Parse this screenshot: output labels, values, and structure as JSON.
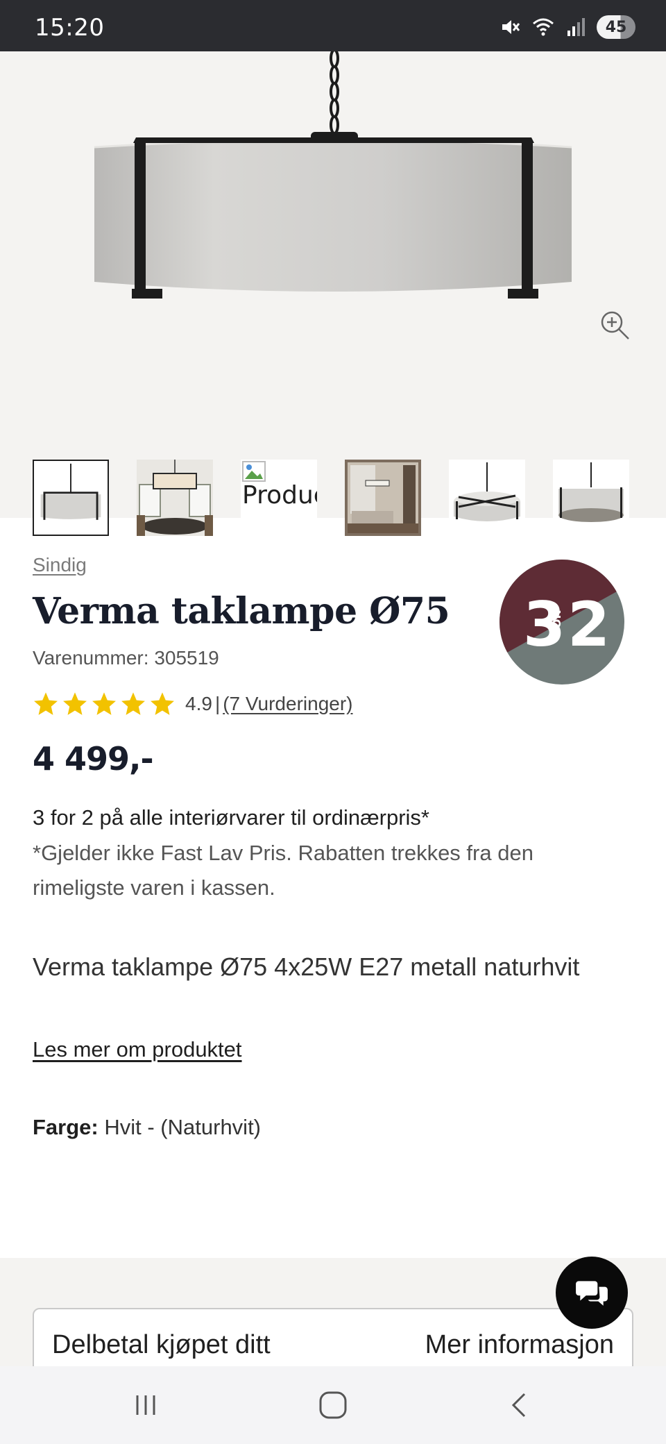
{
  "status_bar": {
    "time": "15:20",
    "battery": "45",
    "icons": [
      "mute-icon",
      "wifi-icon",
      "signal-icon",
      "battery-icon"
    ]
  },
  "gallery": {
    "hero_icon": "pendant-lamp-image",
    "zoom_icon": "zoom-in-icon",
    "thumbnails": [
      {
        "icon": "lamp-front-thumbnail",
        "active": true
      },
      {
        "icon": "lamp-interior-thumbnail",
        "active": false
      },
      {
        "icon": "broken-image-icon",
        "alt_text": "Product gallery",
        "active": false
      },
      {
        "icon": "living-room-thumbnail",
        "active": false
      },
      {
        "icon": "lamp-top-thumbnail",
        "active": false
      },
      {
        "icon": "lamp-bottom-thumbnail",
        "active": false
      }
    ]
  },
  "product": {
    "brand": "Sindig",
    "title": "Verma taklampe Ø75",
    "sku": "Varenummer: 305519",
    "rating_value": "4.9",
    "rating_stars": 5,
    "rating_separator": "|",
    "reviews_link": "(7 Vurderinger)",
    "price": "4 499,-",
    "badge": {
      "left": "3",
      "middle": "FOR",
      "right": "2",
      "colors": {
        "top": "#5e2c35",
        "bottom": "#6f7a78"
      }
    },
    "promo_title": "3 for 2 på alle interiørvarer til ordinærpris*",
    "promo_note": "*Gjelder ikke Fast Lav Pris. Rabatten trekkes fra den rimeligste varen i kassen.",
    "description": "Verma taklampe Ø75 4x25W E27 metall naturhvit",
    "read_more": "Les mer om produktet",
    "color_label": "Farge:",
    "color_value": "Hvit - (Naturhvit)"
  },
  "payment": {
    "left_label": "Delbetal kjøpet ditt",
    "right_label": "Mer informasjon"
  },
  "chat": {
    "icon": "chat-bubbles-icon"
  },
  "nav": {
    "icons": [
      "recent-apps-icon",
      "home-icon",
      "back-icon"
    ]
  },
  "colors": {
    "star": "#f2c200",
    "title": "#181d2b",
    "status_bar": "#2b2c30",
    "gallery_bg": "#f4f3f1"
  }
}
